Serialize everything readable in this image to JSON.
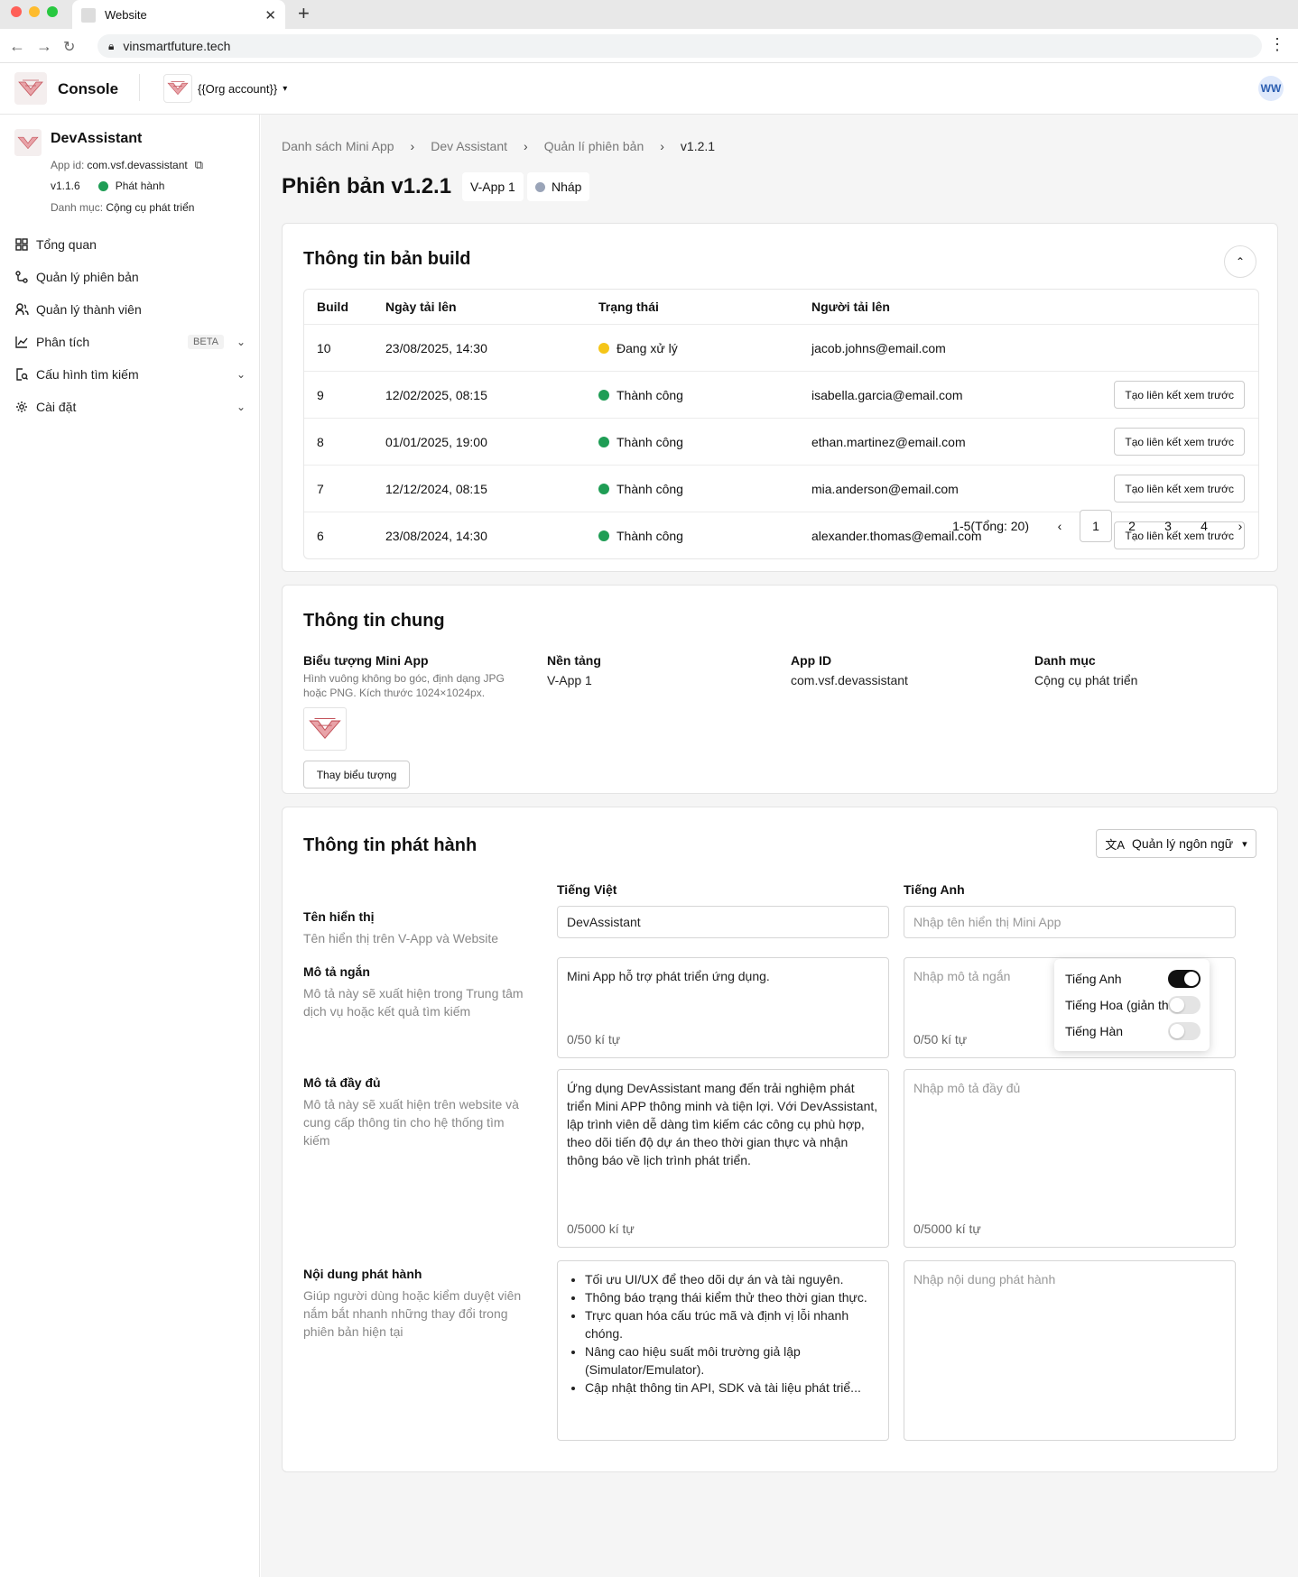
{
  "browser": {
    "tab_title": "Website",
    "url": "vinsmartfuture.tech"
  },
  "header": {
    "app_name": "Console",
    "org_label": "{{Org account}}",
    "avatar_initials": "WW"
  },
  "sidebar": {
    "app_title": "DevAssistant",
    "app_id_label": "App id:",
    "app_id_value": "com.vsf.devassistant",
    "version": "v1.1.6",
    "status": "Phát hành",
    "category_label": "Danh mục:",
    "category_value": "Cộng cụ phát triển",
    "items": [
      {
        "label": "Tổng quan",
        "icon": "grid-icon"
      },
      {
        "label": "Quản lý phiên bản",
        "icon": "branch-icon"
      },
      {
        "label": "Quản lý thành viên",
        "icon": "users-icon"
      },
      {
        "label": "Phân tích",
        "icon": "chart-icon",
        "badge": "BETA"
      },
      {
        "label": "Cấu hình tìm kiếm",
        "icon": "search-config-icon"
      },
      {
        "label": "Cài đặt",
        "icon": "gear-icon"
      }
    ]
  },
  "breadcrumb": [
    "Danh sách Mini App",
    "Dev Assistant",
    "Quản lí phiên bản",
    "v1.2.1"
  ],
  "page": {
    "title": "Phiên bản v1.2.1",
    "platform_chip": "V-App 1",
    "status_chip": "Nháp"
  },
  "build_card": {
    "title": "Thông tin bản build",
    "columns": [
      "Build",
      "Ngày tải lên",
      "Trạng thái",
      "Người tải lên"
    ],
    "rows": [
      {
        "build": "10",
        "date": "23/08/2025, 14:30",
        "status": "Đang xử lý",
        "status_color": "#f5c518",
        "uploader": "jacob.johns@email.com",
        "action": ""
      },
      {
        "build": "9",
        "date": "12/02/2025, 08:15",
        "status": "Thành công",
        "status_color": "#1f9d55",
        "uploader": "isabella.garcia@email.com",
        "action": "Tạo liên kết xem trước"
      },
      {
        "build": "8",
        "date": "01/01/2025, 19:00",
        "status": "Thành công",
        "status_color": "#1f9d55",
        "uploader": "ethan.martinez@email.com",
        "action": "Tạo liên kết xem trước"
      },
      {
        "build": "7",
        "date": "12/12/2024, 08:15",
        "status": "Thành công",
        "status_color": "#1f9d55",
        "uploader": "mia.anderson@email.com",
        "action": "Tạo liên kết xem trước"
      },
      {
        "build": "6",
        "date": "23/08/2024, 14:30",
        "status": "Thành công",
        "status_color": "#1f9d55",
        "uploader": "alexander.thomas@email.com",
        "action": "Tạo liên kết xem trước"
      }
    ],
    "pagination": {
      "summary": "1-5(Tổng: 20)",
      "pages": [
        "1",
        "2",
        "3",
        "4"
      ],
      "current": "1"
    }
  },
  "general_card": {
    "title": "Thông tin chung",
    "icon_label": "Biểu tượng Mini App",
    "icon_hint": "Hình vuông không bo góc, định dạng JPG hoặc PNG. Kích thước 1024×1024px.",
    "change_icon_button": "Thay biểu tượng",
    "platform_label": "Nền tảng",
    "platform_value": "V-App 1",
    "appid_label": "App ID",
    "appid_value": "com.vsf.devassistant",
    "category_label": "Danh mục",
    "category_value": "Cộng cụ phát triển"
  },
  "release_card": {
    "title": "Thông tin phát hành",
    "lang_button": "Quản lý ngôn ngữ",
    "lang_options": [
      {
        "label": "Tiếng Anh",
        "enabled": true
      },
      {
        "label": "Tiếng Hoa (giản thể)",
        "enabled": false
      },
      {
        "label": "Tiếng Hàn",
        "enabled": false
      }
    ],
    "col_vi": "Tiếng Việt",
    "col_en": "Tiếng Anh",
    "display_name": {
      "label": "Tên hiển thị",
      "hint": "Tên hiển thị trên V-App và Website",
      "vi_value": "DevAssistant",
      "en_placeholder": "Nhập tên hiển thị Mini App"
    },
    "short_desc": {
      "label": "Mô tả ngắn",
      "hint": "Mô tả này sẽ xuất hiện trong Trung tâm dịch vụ hoặc kết quả tìm kiếm",
      "vi_value": "Mini App hỗ trợ phát triển ứng dụng.",
      "vi_counter": "0/50 kí tự",
      "en_placeholder": "Nhập mô tả ngắn",
      "en_counter": "0/50 kí tự"
    },
    "full_desc": {
      "label": "Mô tả đầy đủ",
      "hint": "Mô tả này sẽ xuất hiện trên website và cung cấp thông tin cho hệ thống tìm kiếm",
      "vi_value": "Ứng dụng DevAssistant mang đến trải nghiệm phát triển Mini APP thông minh và tiện lợi. Với DevAssistant, lập trình viên dễ dàng tìm kiếm các công cụ phù hợp, theo dõi tiến độ dự án theo thời gian thực và nhận thông báo về lịch trình phát triển.",
      "vi_counter": "0/5000 kí tự",
      "en_placeholder": "Nhập mô tả đầy đủ",
      "en_counter": "0/5000 kí tự"
    },
    "release_notes": {
      "label": "Nội dung phát hành",
      "hint": "Giúp người dùng hoặc kiểm duyệt viên nắm bắt nhanh những thay đổi trong phiên bản hiện tại",
      "vi_items": [
        "Tối ưu UI/UX để theo dõi dự án và tài nguyên.",
        "Thông báo trạng thái kiểm thử theo thời gian thực.",
        "Trực quan hóa cấu trúc mã và định vị lỗi nhanh chóng.",
        "Nâng cao hiệu suất môi trường giả lập (Simulator/Emulator).",
        "Cập nhật thông tin API, SDK và tài liệu phát triể..."
      ],
      "en_placeholder": "Nhập nội dung phát hành"
    }
  }
}
